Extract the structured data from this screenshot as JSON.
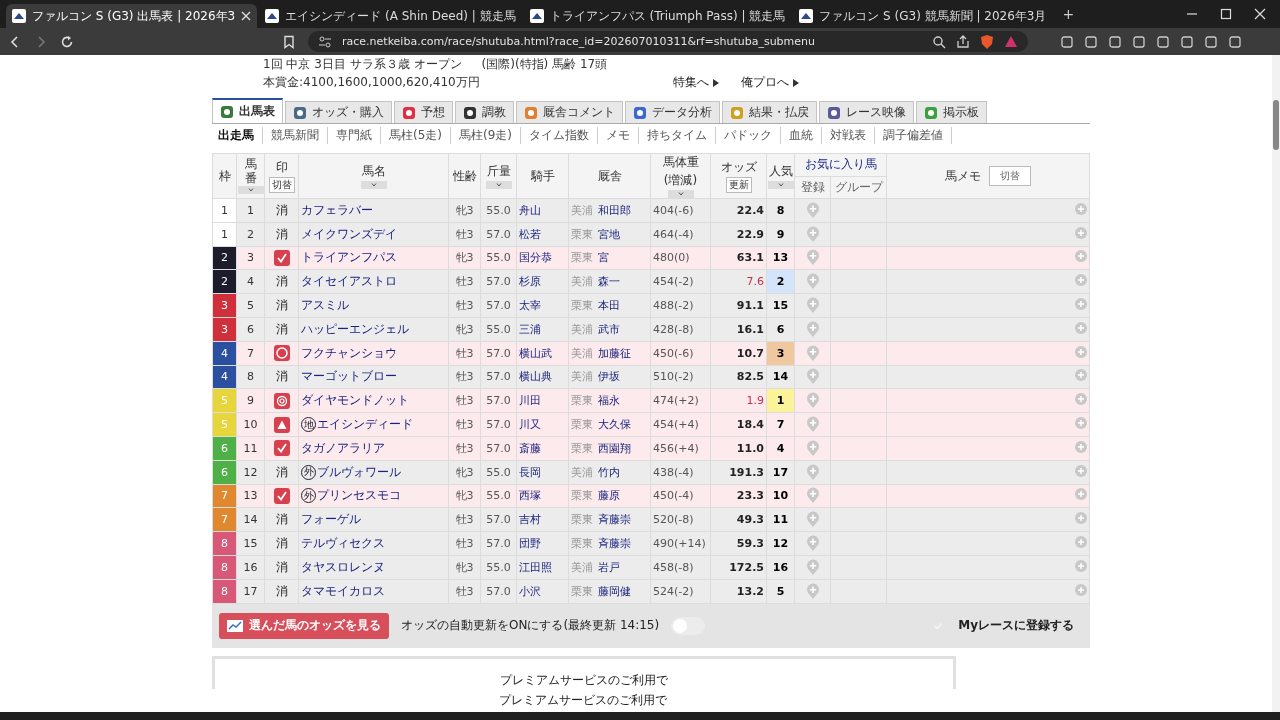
{
  "browser": {
    "tabs": [
      {
        "title": "ファルコン S (G3) 出馬表 | 2026年3",
        "selected": true
      },
      {
        "title": "エイシンディード (A Shin Deed) | 競走馬",
        "selected": false
      },
      {
        "title": "トライアンフパス (Triumph Pass) | 競走馬",
        "selected": false
      },
      {
        "title": "ファルコン S (G3) 競馬新聞 | 2026年3月",
        "selected": false
      }
    ],
    "new_tab": "+",
    "url": "race.netkeiba.com/race/shutuba.html?race_id=202607010311&rf=shutuba_submenu"
  },
  "race_info": {
    "line_1": "1回 中京 3日目 サラ系３歳 オープン",
    "conditions": "(国際)(特指) 馬齢 17頭",
    "prize": "本賞金:4100,1600,1000,620,410万円"
  },
  "header_links": [
    "特集へ",
    "俺プロへ"
  ],
  "main_tabs": [
    {
      "label": "出馬表",
      "selected": true
    },
    {
      "label": "オッズ・購入",
      "selected": false
    },
    {
      "label": "予想",
      "selected": false
    },
    {
      "label": "調教",
      "selected": false
    },
    {
      "label": "厩舎コメント",
      "selected": false
    },
    {
      "label": "データ分析",
      "selected": false
    },
    {
      "label": "結果・払戻",
      "selected": false
    },
    {
      "label": "レース映像",
      "selected": false
    },
    {
      "label": "掲示板",
      "selected": false
    }
  ],
  "sub_tabs": [
    {
      "label": "出走馬",
      "selected": true
    },
    {
      "label": "競馬新聞",
      "selected": false
    },
    {
      "label": "専門紙",
      "selected": false
    },
    {
      "label": "馬柱(5走)",
      "selected": false
    },
    {
      "label": "馬柱(9走)",
      "selected": false
    },
    {
      "label": "タイム指数",
      "selected": false
    },
    {
      "label": "メモ",
      "selected": false
    },
    {
      "label": "持ちタイム",
      "selected": false
    },
    {
      "label": "パドック",
      "selected": false
    },
    {
      "label": "血統",
      "selected": false
    },
    {
      "label": "対戦表",
      "selected": false
    },
    {
      "label": "調子偏差値",
      "selected": false
    }
  ],
  "table": {
    "columns": [
      {
        "label": "枠",
        "sortable": false
      },
      {
        "label": "馬番",
        "sortable": true
      },
      {
        "label": "印",
        "button": "切替",
        "sortable": false
      },
      {
        "label": "馬名",
        "sortable": true
      },
      {
        "label": "性齢",
        "sortable": false
      },
      {
        "label": "斤量",
        "sortable": true
      },
      {
        "label": "騎手",
        "sortable": false
      },
      {
        "label": "厩舎",
        "sortable": false
      },
      {
        "label": "馬体重",
        "sublabel": "(増減)",
        "sortable": true
      },
      {
        "label": "オッズ",
        "button": "更新",
        "sortable": false
      },
      {
        "label": "人気",
        "sortable": true
      }
    ],
    "favorites": {
      "label": "お気に入り馬",
      "columns": [
        "登録",
        "グループ"
      ]
    },
    "memo": {
      "label": "馬メモ",
      "button": "切替"
    },
    "rows": [
      {
        "frame": {
          "number": "1",
          "color": "#ffffff"
        },
        "number": "1",
        "mark": {
          "kind": "erase",
          "text": "消"
        },
        "name": "カフェラバー",
        "sex_age": "牝3",
        "weight": "55.0",
        "jockey": "舟山",
        "stable": "美浦",
        "trainer": "和田郎",
        "body_weight": "404(-6)",
        "odds": "22.4",
        "odds_hot": false,
        "popularity": {
          "rank": "8"
        }
      },
      {
        "frame": {
          "number": "1",
          "color": "#ffffff"
        },
        "number": "2",
        "mark": {
          "kind": "erase",
          "text": "消"
        },
        "name": "メイクワンズデイ",
        "sex_age": "牡3",
        "weight": "57.0",
        "jockey": "松若",
        "stable": "栗東",
        "trainer": "宮地",
        "body_weight": "464(-4)",
        "odds": "22.9",
        "odds_hot": false,
        "popularity": {
          "rank": "9"
        }
      },
      {
        "frame": {
          "number": "2",
          "color": "#1c1c2c"
        },
        "number": "3",
        "mark": {
          "kind": "check"
        },
        "name": "トライアンフパス",
        "sex_age": "牝3",
        "weight": "55.0",
        "jockey": "国分恭",
        "stable": "栗東",
        "trainer": "宮",
        "body_weight": "480(0)",
        "odds": "63.1",
        "odds_hot": false,
        "popularity": {
          "rank": "13"
        }
      },
      {
        "frame": {
          "number": "2",
          "color": "#1c1c2c"
        },
        "number": "4",
        "mark": {
          "kind": "erase",
          "text": "消"
        },
        "name": "タイセイアストロ",
        "sex_age": "牡3",
        "weight": "57.0",
        "jockey": "杉原",
        "stable": "美浦",
        "trainer": "森一",
        "body_weight": "454(-2)",
        "odds": "7.6",
        "odds_hot": true,
        "popularity": {
          "rank": "2",
          "color": "#d4e4fa"
        }
      },
      {
        "frame": {
          "number": "3",
          "color": "#d0303c"
        },
        "number": "5",
        "mark": {
          "kind": "erase",
          "text": "消"
        },
        "name": "アスミル",
        "sex_age": "牡3",
        "weight": "57.0",
        "jockey": "太宰",
        "stable": "栗東",
        "trainer": "本田",
        "body_weight": "488(-2)",
        "odds": "91.1",
        "odds_hot": false,
        "popularity": {
          "rank": "15"
        }
      },
      {
        "frame": {
          "number": "3",
          "color": "#d0303c"
        },
        "number": "6",
        "mark": {
          "kind": "erase",
          "text": "消"
        },
        "name": "ハッピーエンジェル",
        "sex_age": "牝3",
        "weight": "55.0",
        "jockey": "三浦",
        "stable": "美浦",
        "trainer": "武市",
        "body_weight": "428(-8)",
        "odds": "16.1",
        "odds_hot": false,
        "popularity": {
          "rank": "6"
        }
      },
      {
        "frame": {
          "number": "4",
          "color": "#2c50a0"
        },
        "number": "7",
        "mark": {
          "kind": "circle"
        },
        "name": "フクチャンショウ",
        "sex_age": "牡3",
        "weight": "57.0",
        "jockey": "横山武",
        "stable": "美浦",
        "trainer": "加藤征",
        "body_weight": "450(-6)",
        "odds": "10.7",
        "odds_hot": false,
        "popularity": {
          "rank": "3",
          "color": "#f0c8a0"
        }
      },
      {
        "frame": {
          "number": "4",
          "color": "#2c50a0"
        },
        "number": "8",
        "mark": {
          "kind": "erase",
          "text": "消"
        },
        "name": "マーゴットブロー",
        "sex_age": "牡3",
        "weight": "57.0",
        "jockey": "横山典",
        "stable": "美浦",
        "trainer": "伊坂",
        "body_weight": "510(-2)",
        "odds": "82.5",
        "odds_hot": false,
        "popularity": {
          "rank": "14"
        }
      },
      {
        "frame": {
          "number": "5",
          "color": "#e6d63c"
        },
        "number": "9",
        "mark": {
          "kind": "double"
        },
        "name": "ダイヤモンドノット",
        "sex_age": "牡3",
        "weight": "57.0",
        "jockey": "川田",
        "stable": "栗東",
        "trainer": "福永",
        "body_weight": "474(+2)",
        "odds": "1.9",
        "odds_hot": true,
        "popularity": {
          "rank": "1",
          "color": "#fbf29a"
        }
      },
      {
        "frame": {
          "number": "5",
          "color": "#e6d63c"
        },
        "number": "10",
        "mark": {
          "kind": "triangle"
        },
        "origin": "地",
        "name": "エイシンディード",
        "sex_age": "牡3",
        "weight": "57.0",
        "jockey": "川又",
        "stable": "栗東",
        "trainer": "大久保",
        "body_weight": "454(+4)",
        "odds": "18.4",
        "odds_hot": false,
        "popularity": {
          "rank": "7"
        }
      },
      {
        "frame": {
          "number": "6",
          "color": "#50b048"
        },
        "number": "11",
        "mark": {
          "kind": "check"
        },
        "name": "タガノアラリア",
        "sex_age": "牡3",
        "weight": "57.0",
        "jockey": "斎藤",
        "stable": "栗東",
        "trainer": "西園翔",
        "body_weight": "456(+4)",
        "odds": "11.0",
        "odds_hot": false,
        "popularity": {
          "rank": "4"
        }
      },
      {
        "frame": {
          "number": "6",
          "color": "#50b048"
        },
        "number": "12",
        "mark": {
          "kind": "erase",
          "text": "消"
        },
        "origin": "外",
        "name": "ブルヴォワール",
        "sex_age": "牝3",
        "weight": "55.0",
        "jockey": "長岡",
        "stable": "美浦",
        "trainer": "竹内",
        "body_weight": "438(-4)",
        "odds": "191.3",
        "odds_hot": false,
        "popularity": {
          "rank": "17"
        }
      },
      {
        "frame": {
          "number": "7",
          "color": "#e08830"
        },
        "number": "13",
        "mark": {
          "kind": "check"
        },
        "origin": "外",
        "name": "プリンセスモコ",
        "sex_age": "牝3",
        "weight": "55.0",
        "jockey": "西塚",
        "stable": "栗東",
        "trainer": "藤原",
        "body_weight": "450(-4)",
        "odds": "23.3",
        "odds_hot": false,
        "popularity": {
          "rank": "10"
        }
      },
      {
        "frame": {
          "number": "7",
          "color": "#e08830"
        },
        "number": "14",
        "mark": {
          "kind": "erase",
          "text": "消"
        },
        "name": "フォーゲル",
        "sex_age": "牡3",
        "weight": "57.0",
        "jockey": "吉村",
        "stable": "栗東",
        "trainer": "斉藤崇",
        "body_weight": "520(-8)",
        "odds": "49.3",
        "odds_hot": false,
        "popularity": {
          "rank": "11"
        }
      },
      {
        "frame": {
          "number": "8",
          "color": "#d85878"
        },
        "number": "15",
        "mark": {
          "kind": "erase",
          "text": "消"
        },
        "name": "テルヴィセクス",
        "sex_age": "牡3",
        "weight": "57.0",
        "jockey": "団野",
        "stable": "栗東",
        "trainer": "斉藤崇",
        "body_weight": "490(+14)",
        "odds": "59.3",
        "odds_hot": false,
        "popularity": {
          "rank": "12"
        }
      },
      {
        "frame": {
          "number": "8",
          "color": "#d85878"
        },
        "number": "16",
        "mark": {
          "kind": "erase",
          "text": "消"
        },
        "name": "タヤスロレンヌ",
        "sex_age": "牝3",
        "weight": "55.0",
        "jockey": "江田照",
        "stable": "美浦",
        "trainer": "岩戸",
        "body_weight": "458(-8)",
        "odds": "172.5",
        "odds_hot": false,
        "popularity": {
          "rank": "16"
        }
      },
      {
        "frame": {
          "number": "8",
          "color": "#d85878"
        },
        "number": "17",
        "mark": {
          "kind": "erase",
          "text": "消"
        },
        "name": "タマモイカロス",
        "sex_age": "牡3",
        "weight": "57.0",
        "jockey": "小沢",
        "stable": "栗東",
        "trainer": "藤岡健",
        "body_weight": "524(-2)",
        "odds": "13.2",
        "odds_hot": false,
        "popularity": {
          "rank": "5"
        }
      }
    ]
  },
  "action_bar": {
    "odds_button": "選んだ馬のオッズを見る",
    "auto_update_label": "オッズの自動更新をONにする(最終更新 14:15)",
    "auto_update": {
      "on": false
    },
    "my_race": {
      "label": "Myレースに登録する",
      "checked": false
    }
  },
  "premium": [
    "プレミアムサービスのご利用で",
    "プレミアムサービスのご利用で"
  ]
}
